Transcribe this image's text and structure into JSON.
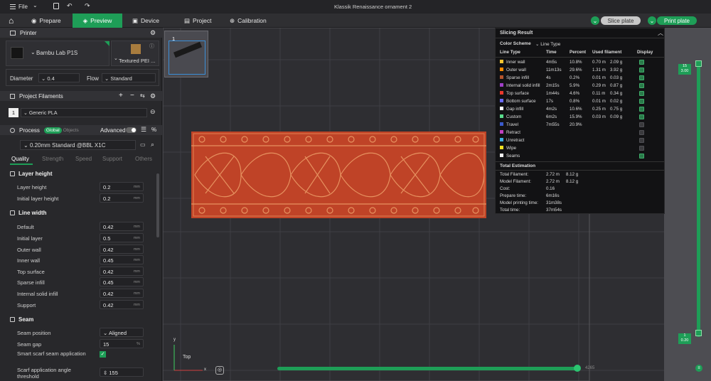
{
  "titlebar": {
    "menu_label": "File",
    "window_title": "Klassik Renaissance ornament 2"
  },
  "toolbar": {
    "tabs": [
      {
        "label": "Prepare"
      },
      {
        "label": "Preview"
      },
      {
        "label": "Device"
      },
      {
        "label": "Project"
      },
      {
        "label": "Calibration"
      }
    ],
    "slice_label": "Slice plate",
    "print_label": "Print plate"
  },
  "printer": {
    "section_title": "Printer",
    "name": "Bambu Lab P1S",
    "plate": "Textured PEI ...",
    "diameter_label": "Diameter",
    "diameter_value": "0.4",
    "flow_label": "Flow",
    "flow_value": "Standard"
  },
  "filaments": {
    "section_title": "Project Filaments",
    "items": [
      {
        "index": "1",
        "name": "Generic PLA"
      }
    ]
  },
  "process": {
    "section_title": "Process",
    "global_label": "Global",
    "objects_label": "Objects",
    "advanced_label": "Advanced",
    "profile": "0.20mm Standard @BBL X1C",
    "tabs": [
      {
        "label": "Quality"
      },
      {
        "label": "Strength"
      },
      {
        "label": "Speed"
      },
      {
        "label": "Support"
      },
      {
        "label": "Others"
      }
    ]
  },
  "settings": {
    "layer_height": {
      "title": "Layer height",
      "rows": [
        {
          "label": "Layer height",
          "value": "0.2",
          "unit": "mm"
        },
        {
          "label": "Initial layer height",
          "value": "0.2",
          "unit": "mm"
        }
      ]
    },
    "line_width": {
      "title": "Line width",
      "rows": [
        {
          "label": "Default",
          "value": "0.42",
          "unit": "mm"
        },
        {
          "label": "Initial layer",
          "value": "0.5",
          "unit": "mm"
        },
        {
          "label": "Outer wall",
          "value": "0.42",
          "unit": "mm"
        },
        {
          "label": "Inner wall",
          "value": "0.45",
          "unit": "mm"
        },
        {
          "label": "Top surface",
          "value": "0.42",
          "unit": "mm"
        },
        {
          "label": "Sparse infill",
          "value": "0.45",
          "unit": "mm"
        },
        {
          "label": "Internal solid infill",
          "value": "0.42",
          "unit": "mm"
        },
        {
          "label": "Support",
          "value": "0.42",
          "unit": "mm"
        }
      ]
    },
    "seam": {
      "title": "Seam",
      "position_label": "Seam position",
      "position_value": "Aligned",
      "gap_label": "Seam gap",
      "gap_value": "15",
      "gap_unit": "%",
      "scarf_label": "Smart scarf seam application",
      "angle_label": "Scarf application angle threshold",
      "angle_value": "155"
    }
  },
  "plate_thumb": {
    "number": "1"
  },
  "slicing_result": {
    "title": "Slicing Result",
    "color_scheme_label": "Color Scheme",
    "color_scheme_value": "Line Type",
    "headers": {
      "type": "Line Type",
      "time": "Time",
      "percent": "Percent",
      "filament": "Used filament",
      "display": "Display"
    },
    "rows": [
      {
        "name": "Inner wall",
        "time": "4m5s",
        "percent": "10.8%",
        "m": "0.70 m",
        "g": "2.09 g",
        "color": "#f4c430",
        "display": true
      },
      {
        "name": "Outer wall",
        "time": "11m13s",
        "percent": "29.6%",
        "m": "1.31 m",
        "g": "3.92 g",
        "color": "#ff8c00",
        "display": true
      },
      {
        "name": "Sparse infill",
        "time": "4s",
        "percent": "0.2%",
        "m": "0.01 m",
        "g": "0.03 g",
        "color": "#b5542c",
        "display": true
      },
      {
        "name": "Internal solid infill",
        "time": "2m15s",
        "percent": "5.9%",
        "m": "0.29 m",
        "g": "0.87 g",
        "color": "#a040c8",
        "display": true
      },
      {
        "name": "Top surface",
        "time": "1m44s",
        "percent": "4.6%",
        "m": "0.11 m",
        "g": "0.34 g",
        "color": "#e8382c",
        "display": true
      },
      {
        "name": "Bottom surface",
        "time": "17s",
        "percent": "0.8%",
        "m": "0.01 m",
        "g": "0.02 g",
        "color": "#6a6aff",
        "display": true
      },
      {
        "name": "Gap infill",
        "time": "4m2s",
        "percent": "10.6%",
        "m": "0.25 m",
        "g": "0.75 g",
        "color": "#ffffff",
        "display": true
      },
      {
        "name": "Custom",
        "time": "6m2s",
        "percent": "15.9%",
        "m": "0.03 m",
        "g": "0.09 g",
        "color": "#5adc8c",
        "display": true
      },
      {
        "name": "Travel",
        "time": "7m55s",
        "percent": "20.9%",
        "m": "",
        "g": "",
        "color": "#3a5acc",
        "display": false
      },
      {
        "name": "Retract",
        "time": "",
        "percent": "",
        "m": "",
        "g": "",
        "color": "#c040c0",
        "display": false
      },
      {
        "name": "Unretract",
        "time": "",
        "percent": "",
        "m": "",
        "g": "",
        "color": "#40b0e0",
        "display": false
      },
      {
        "name": "Wipe",
        "time": "",
        "percent": "",
        "m": "",
        "g": "",
        "color": "#f0e020",
        "display": false
      },
      {
        "name": "Seams",
        "time": "",
        "percent": "",
        "m": "",
        "g": "",
        "color": "#f0f0f0",
        "display": true
      }
    ],
    "estimation_title": "Total Estimation",
    "estimation": [
      {
        "label": "Total Filament:",
        "v1": "2.72 m",
        "v2": "8.12 g"
      },
      {
        "label": "Model Filament:",
        "v1": "2.72 m",
        "v2": "8.12 g"
      },
      {
        "label": "Cost:",
        "v1": "0.16",
        "v2": ""
      },
      {
        "label": "Prepare time:",
        "v1": "6m16s",
        "v2": ""
      },
      {
        "label": "Model printing time:",
        "v1": "31m38s",
        "v2": ""
      },
      {
        "label": "Total time:",
        "v1": "37m54s",
        "v2": ""
      }
    ]
  },
  "layer_slider": {
    "top_label": "15",
    "top_value": "3.00",
    "bottom_label": "1",
    "bottom_value": "0.20"
  },
  "view_label": "Top",
  "axes": {
    "x": "x",
    "y": "y"
  },
  "move_slider": {
    "label": "4265",
    "value": 1.0
  },
  "colors": {
    "accent": "#1e9e57",
    "model": "#c4452a"
  }
}
